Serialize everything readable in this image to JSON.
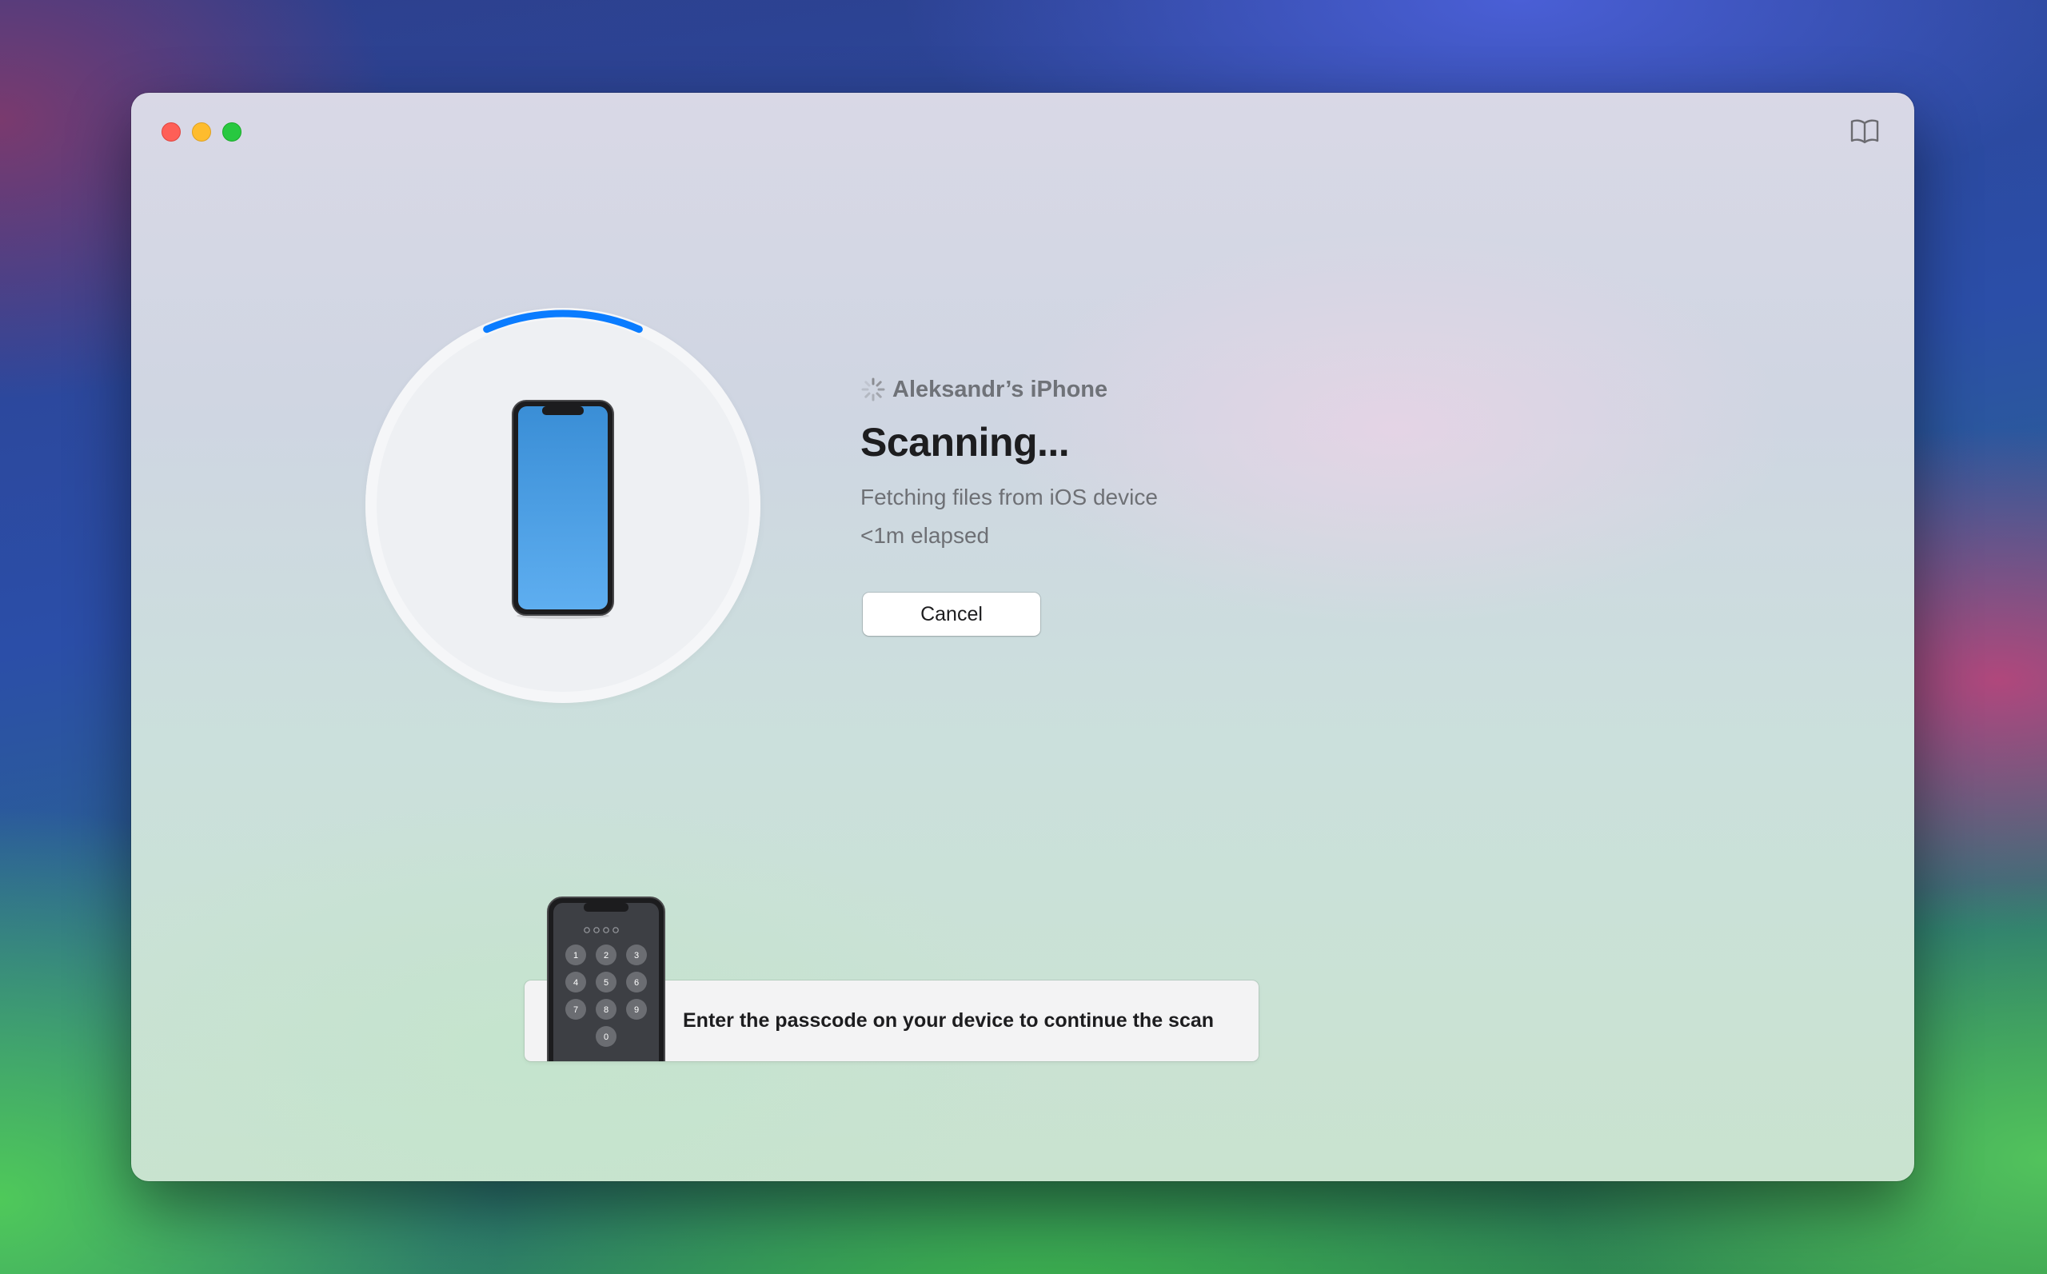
{
  "window": {
    "toolbar": {
      "guide_icon": "book-open-icon"
    }
  },
  "scan": {
    "progress": 0.13,
    "device_icon": "spinner-icon",
    "device_name": "Aleksandr’s iPhone",
    "title": "Scanning...",
    "status": "Fetching files from iOS device",
    "elapsed": "<1m elapsed",
    "cancel_label": "Cancel"
  },
  "passcode_prompt": {
    "message": "Enter the passcode on your device to continue the scan",
    "keypad_keys": [
      "1",
      "2",
      "3",
      "4",
      "5",
      "6",
      "7",
      "8",
      "9",
      "0"
    ]
  },
  "colors": {
    "accent": "#0a7cff",
    "close": "#fe5f57",
    "minimize": "#febc2e",
    "maximize": "#28c840"
  }
}
